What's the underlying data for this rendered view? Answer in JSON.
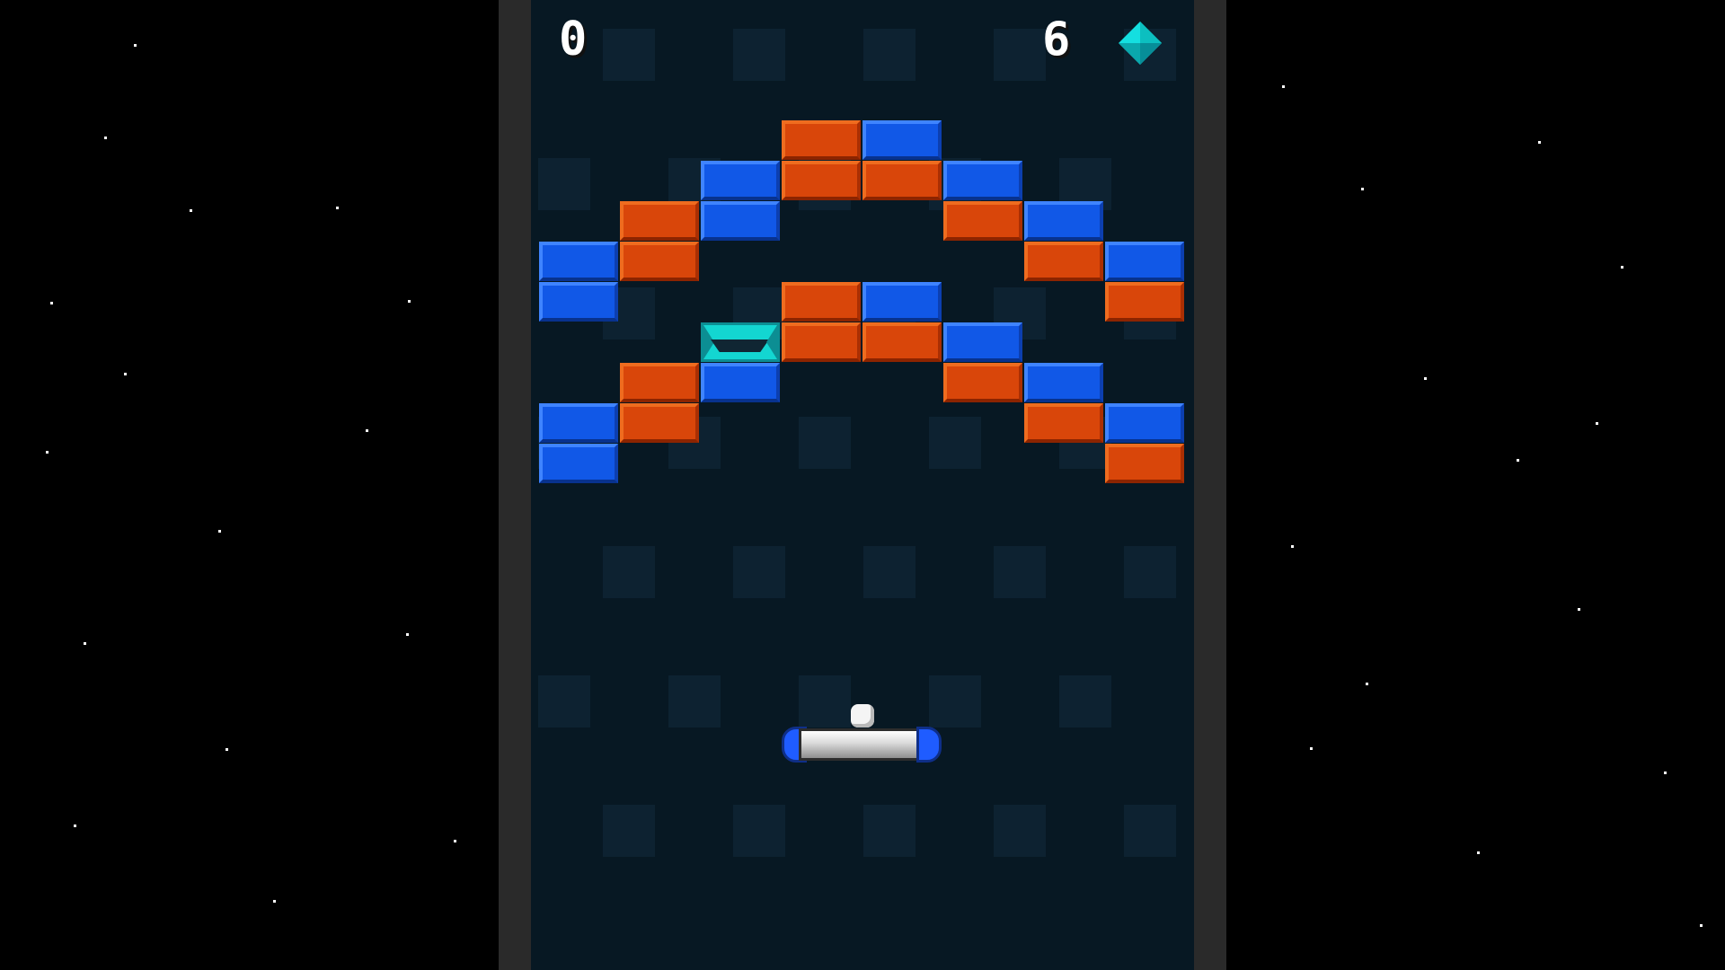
{
  "hud": {
    "score": "0",
    "gem_count": "6",
    "gem_icon": "cyan-diamond-icon"
  },
  "game": {
    "player": "paddle",
    "projectile": "ball"
  },
  "colors": {
    "background": "#000000",
    "board": "#071823",
    "orange_brick": "#d9460a",
    "blue_brick": "#1158e7",
    "cyan_brick": "#13d6d1",
    "text": "#ffffff"
  }
}
